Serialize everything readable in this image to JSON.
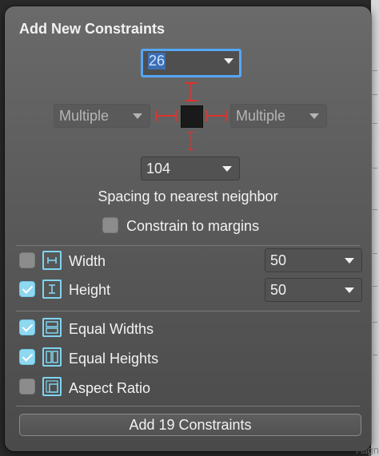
{
  "popover": {
    "title": "Add New Constraints",
    "top_spacing": "26",
    "left_spacing": "Multiple",
    "right_spacing": "Multiple",
    "bottom_spacing": "104",
    "spacing_caption": "Spacing to nearest neighbor",
    "constrain_margins": {
      "label": "Constrain to margins",
      "checked": false
    }
  },
  "size": {
    "width": {
      "label": "Width",
      "value": "50",
      "checked": false
    },
    "height": {
      "label": "Height",
      "value": "50",
      "checked": true
    }
  },
  "equal": {
    "equal_widths": {
      "label": "Equal Widths",
      "checked": true
    },
    "equal_heights": {
      "label": "Equal Heights",
      "checked": true
    },
    "aspect_ratio": {
      "label": "Aspect Ratio",
      "checked": false
    }
  },
  "add_button_label": "Add 19 Constraints",
  "background_peek_text": "Align",
  "colors": {
    "accent": "#56a7f5",
    "constraint_red": "#e0322f",
    "icon_cyan": "#7fd4ef"
  }
}
